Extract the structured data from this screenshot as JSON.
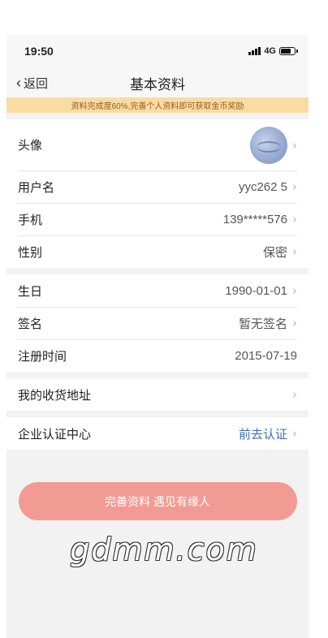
{
  "status_bar": {
    "time": "19:50",
    "network": "4G"
  },
  "nav": {
    "back_label": "返回",
    "title": "基本资料"
  },
  "banner": {
    "text": "资料完成度60%,完善个人资料即可获取金币奖励"
  },
  "profile": {
    "avatar_label": "头像",
    "username_label": "用户名",
    "username_value": "yyc262  5",
    "phone_label": "手机",
    "phone_value": "139*****576",
    "gender_label": "性别",
    "gender_value": "保密",
    "birthday_label": "生日",
    "birthday_value": "1990-01-01",
    "signature_label": "签名",
    "signature_value": "暂无签名",
    "register_label": "注册时间",
    "register_value": "2015-07-19",
    "address_label": "我的收货地址",
    "enterprise_label": "企业认证中心",
    "enterprise_value": "前去认证"
  },
  "cta": {
    "label": "完善资料 遇见有缘人"
  },
  "watermark": {
    "text": "gdmm.com"
  },
  "colors": {
    "banner_bg": "#f9dca4",
    "banner_text": "#9a5a17",
    "cta_bg": "#f29b94",
    "link": "#3c6ec4"
  },
  "icons": {
    "back": "chevron-left-icon",
    "row_arrow": "chevron-right-icon"
  }
}
